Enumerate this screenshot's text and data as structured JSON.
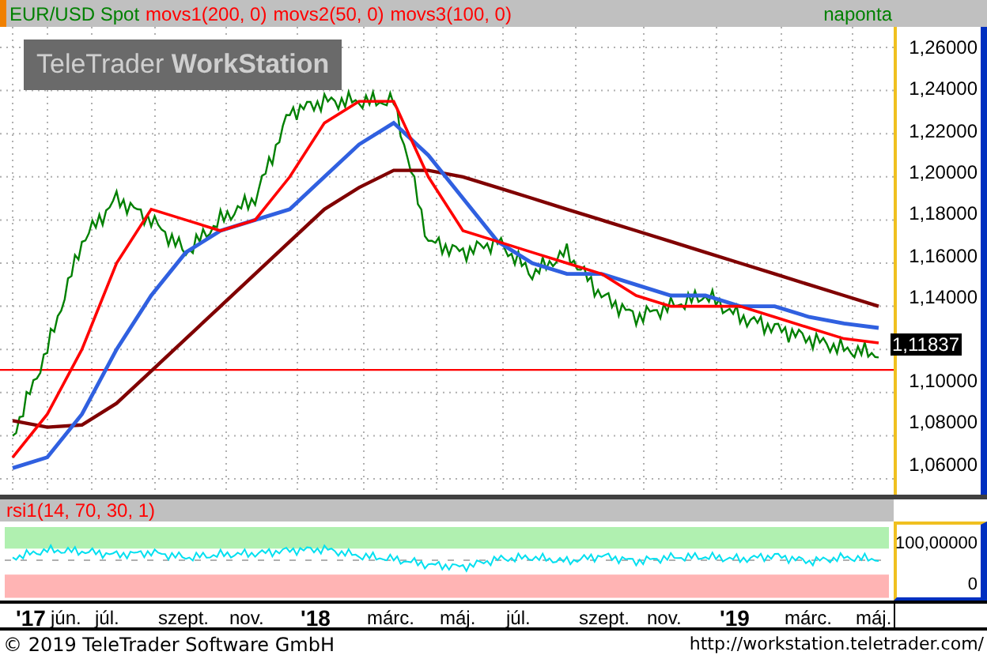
{
  "header": {
    "instrument": "EUR/USD Spot",
    "indicators": [
      "movs1(200, 0)",
      "movs2(50, 0)",
      "movs3(100, 0)"
    ],
    "interval": "naponta"
  },
  "brand": {
    "light": "TeleTrader",
    "bold": "WorkStation"
  },
  "price_axis": [
    {
      "kind": "tick",
      "label": "1,26000"
    },
    {
      "kind": "tick",
      "label": "1,24000"
    },
    {
      "kind": "tick",
      "label": "1,22000"
    },
    {
      "kind": "tick",
      "label": "1,20000"
    },
    {
      "kind": "tick",
      "label": "1,18000"
    },
    {
      "kind": "tick",
      "label": "1,16000"
    },
    {
      "kind": "tick",
      "label": "1,14000"
    },
    {
      "kind": "last_price",
      "label": "1,11837"
    },
    {
      "kind": "tick",
      "label": "1,10000"
    },
    {
      "kind": "tick",
      "label": "1,08000"
    },
    {
      "kind": "tick",
      "label": "1,06000"
    }
  ],
  "indicator_panel": {
    "title": "rsi1(14, 70, 30, 1)",
    "axis": [
      "100,00000",
      "0"
    ]
  },
  "time_axis": [
    {
      "kind": "year",
      "label": "'17"
    },
    {
      "kind": "month",
      "label": "jún."
    },
    {
      "kind": "month",
      "label": "júl."
    },
    {
      "kind": "month",
      "label": "szept."
    },
    {
      "kind": "month",
      "label": "nov."
    },
    {
      "kind": "year",
      "label": "'18"
    },
    {
      "kind": "month",
      "label": "márc."
    },
    {
      "kind": "month",
      "label": "máj."
    },
    {
      "kind": "month",
      "label": "júl."
    },
    {
      "kind": "month",
      "label": "szept."
    },
    {
      "kind": "month",
      "label": "nov."
    },
    {
      "kind": "year",
      "label": "'19"
    },
    {
      "kind": "month",
      "label": "márc."
    },
    {
      "kind": "month",
      "label": "máj."
    }
  ],
  "footer": {
    "copyright": "© 2019 TeleTrader Software GmbH",
    "url": "http://workstation.teletrader.com/"
  }
}
